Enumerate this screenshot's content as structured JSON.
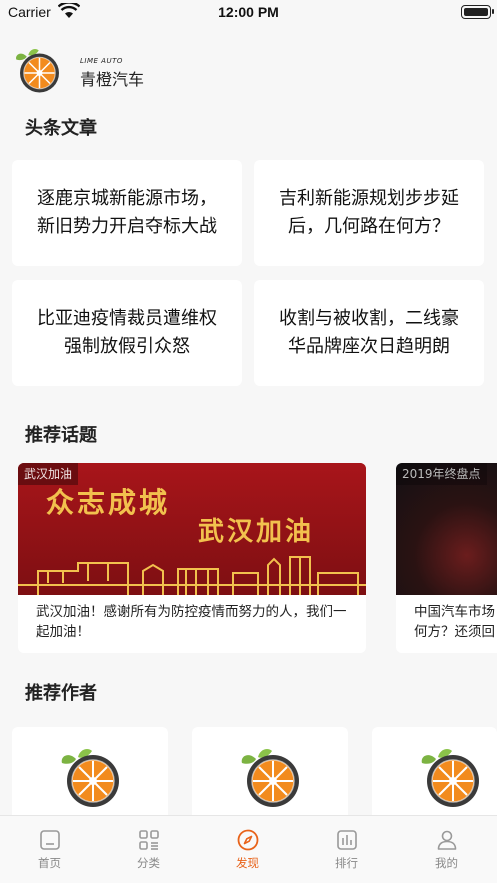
{
  "status_bar": {
    "carrier": "Carrier",
    "time": "12:00 PM"
  },
  "brand": {
    "name_en": "LIME AUTO",
    "name_cn": "青橙汽车"
  },
  "headlines": {
    "title": "头条文章",
    "items": [
      {
        "title": "逐鹿京城新能源市场，新旧势力开启夺标大战"
      },
      {
        "title": "吉利新能源规划步步延后，几何路在何方？"
      },
      {
        "title": "比亚迪疫情裁员遭维权强制放假引众怒"
      },
      {
        "title": "收割与被收割，二线豪华品牌座次日趋明朗"
      }
    ]
  },
  "topics": {
    "title": "推荐话题",
    "items": [
      {
        "tag": "武汉加油",
        "banner_line1": "众志成城",
        "banner_line2": "武汉加油",
        "text": "武汉加油！感谢所有为防控疫情而努力的人，我们一起加油！"
      },
      {
        "tag": "2019年终盘点",
        "text": "中国汽车市场何方？还须回"
      }
    ]
  },
  "authors": {
    "title": "推荐作者",
    "count": 3
  },
  "tabbar": {
    "active": "discover",
    "items": [
      {
        "id": "home",
        "label": "首页"
      },
      {
        "id": "category",
        "label": "分类"
      },
      {
        "id": "discover",
        "label": "发现"
      },
      {
        "id": "ranking",
        "label": "排行"
      },
      {
        "id": "mine",
        "label": "我的"
      }
    ]
  },
  "colors": {
    "accent": "#e8631a",
    "orange": "#f07d1c",
    "banner_red": "#9c1418",
    "banner_gold": "#f2c14e"
  }
}
